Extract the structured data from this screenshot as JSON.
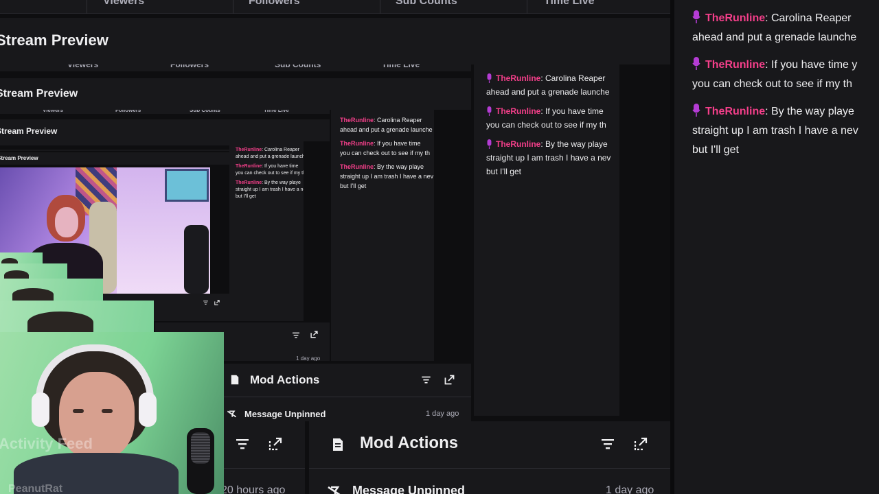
{
  "tabs": [
    "Viewers",
    "Followers",
    "Sub Counts",
    "Time Live"
  ],
  "preview": {
    "title": "Stream Preview"
  },
  "chat": {
    "messages": [
      {
        "user": "TheRunline",
        "line1": ": Carolina Reaper",
        "line2": "ahead and put a grenade launche"
      },
      {
        "user": "TheRunline",
        "line1": ": If you have time y",
        "line2": "you can check out to see if my th"
      },
      {
        "user": "TheRunline",
        "line1": ": By the way playe",
        "line2": "straight up I am trash I have a nev",
        "line3": "but I'll get"
      }
    ],
    "nested_messages": [
      {
        "user": "TheRunline",
        "line1": ": Carolina Reaper",
        "line2": "ahead and put a grenade launche"
      },
      {
        "user": "TheRunline",
        "line1": ": If you have time",
        "line2": "you can check out to see if my th"
      },
      {
        "user": "TheRunline",
        "line1": ": By the way playe",
        "line2": "straight up I am trash I have a nev",
        "line3": "but I'll get"
      }
    ]
  },
  "activity_feed": {
    "title": "Activity Feed",
    "user": "PeanutRat",
    "time": "20 hours ago"
  },
  "mod_actions": {
    "title": "Mod Actions",
    "action": "Message Unpinned",
    "time": "1 day ago"
  },
  "colors": {
    "background": "#0e0e10",
    "panel": "#18181b",
    "username": "#f43f8a",
    "mic_icon": "#b43cd4",
    "muted_text": "#adadb8"
  },
  "icons": [
    "mic-icon",
    "filter-icon",
    "popout-icon",
    "document-icon",
    "unpin-icon"
  ]
}
